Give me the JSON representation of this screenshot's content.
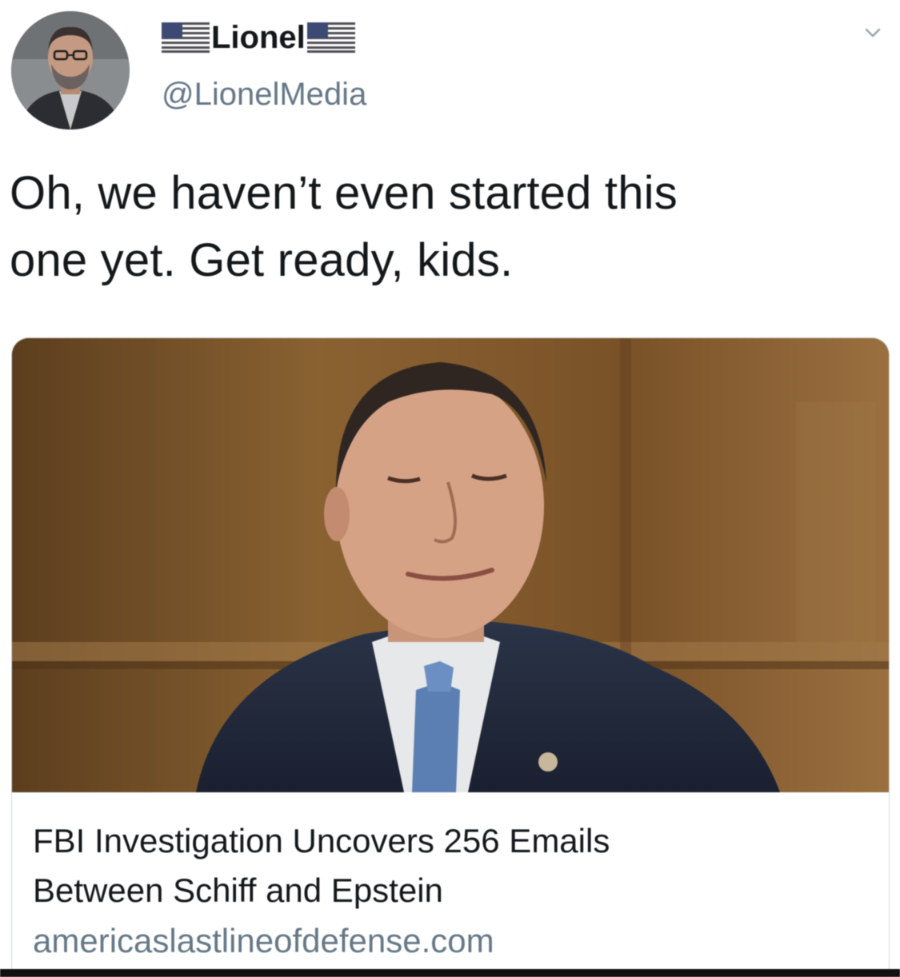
{
  "tweet": {
    "display_name": "Lionel",
    "handle": "@LionelMedia",
    "text_lines": [
      "Oh, we haven’t even started this",
      "one yet. Get ready, kids."
    ],
    "icons": {
      "name_prefix": "us-flag-icon",
      "name_suffix": "us-flag-icon",
      "menu": "chevron-down-icon"
    }
  },
  "link_card": {
    "title_lines": [
      "FBI Investigation Uncovers 256 Emails",
      "Between Schiff and Epstein"
    ],
    "domain": "americaslastlineofdefense.com"
  },
  "colors": {
    "text_primary": "#14171a",
    "text_secondary": "#657786",
    "card_border": "#d4d9dd"
  }
}
